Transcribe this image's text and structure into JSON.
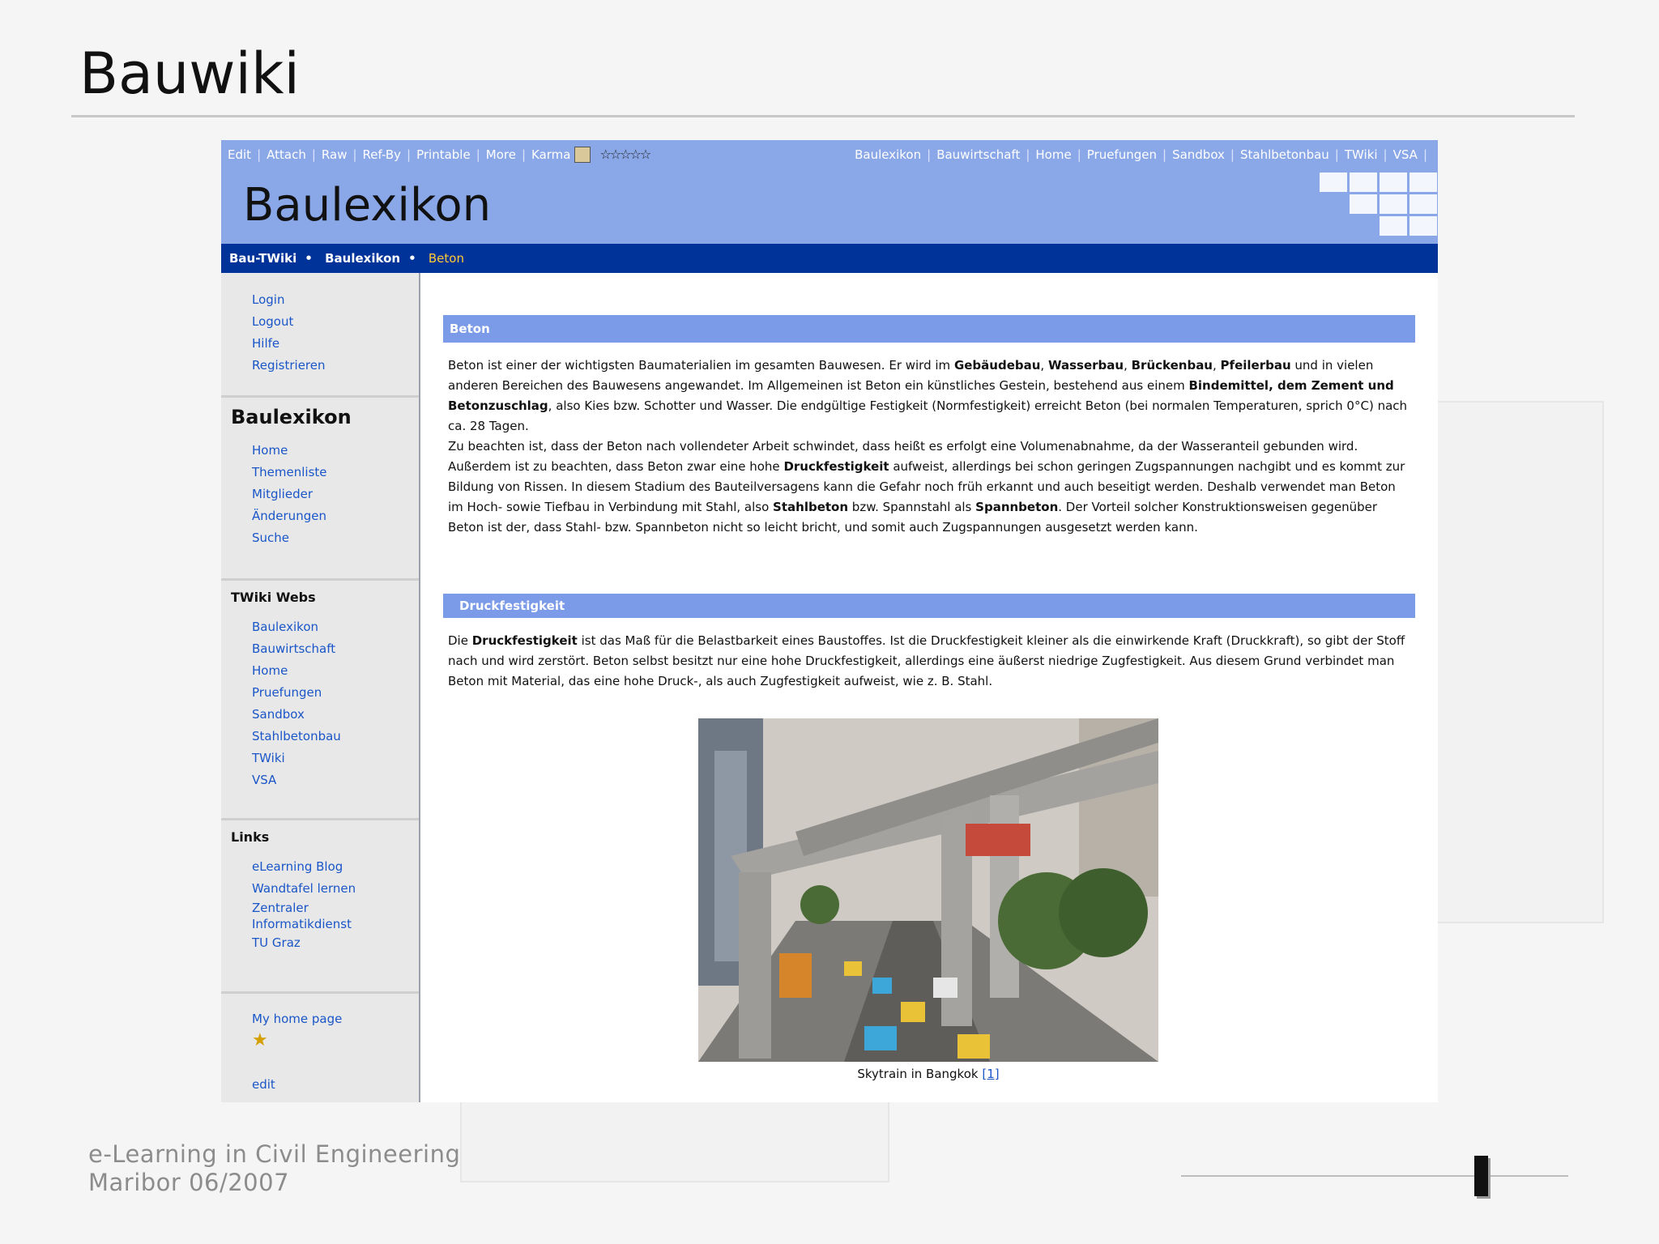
{
  "slide": {
    "title": "Bauwiki",
    "footer_line1": "e-Learning in Civil Engineering",
    "footer_line2": "Maribor 06/2007"
  },
  "toolbar": {
    "left_links": [
      "Edit",
      "Attach",
      "Raw",
      "Ref-By",
      "Printable",
      "More",
      "Karma"
    ],
    "rating_glyph": "☆☆☆☆☆",
    "right_links": [
      "Baulexikon",
      "Bauwirtschaft",
      "Home",
      "Pruefungen",
      "Sandbox",
      "Stahlbetonbau",
      "TWiki",
      "VSA"
    ]
  },
  "web_title": "Baulexikon",
  "breadcrumb": {
    "items": [
      "Bau-TWiki",
      "Baulexikon"
    ],
    "current": "Beton"
  },
  "sidebar": {
    "account_links": [
      "Login",
      "Logout",
      "Hilfe",
      "Registrieren"
    ],
    "web_heading": "Baulexikon",
    "web_links": [
      "Home",
      "Themenliste",
      "Mitglieder",
      "Änderungen",
      "Suche"
    ],
    "webs_heading": "TWiki Webs",
    "webs_links": [
      "Baulexikon",
      "Bauwirtschaft",
      "Home",
      "Pruefungen",
      "Sandbox",
      "Stahlbetonbau",
      "TWiki",
      "VSA"
    ],
    "links_heading": "Links",
    "links": [
      "eLearning Blog",
      "Wandtafel lernen",
      "Zentraler Informatikdienst",
      "TU Graz"
    ],
    "home_link": "My home page",
    "edit_link": "edit"
  },
  "article": {
    "section1_title": "Beton",
    "p1_a": "Beton ist einer der wichtigsten Baumaterialien im gesamten Bauwesen. Er wird im ",
    "p1_k1": "Gebäudebau",
    "p1_s1": ", ",
    "p1_k2": "Wasserbau",
    "p1_s2": ", ",
    "p1_k3": "Brückenbau",
    "p1_s3": ", ",
    "p1_k4": "Pfeilerbau",
    "p1_b": " und in vielen anderen Bereichen des Bauwesens angewandet. Im Allgemeinen ist Beton ein künstliches Gestein, bestehend aus einem ",
    "p1_k5": "Bindemittel, dem Zement und Betonzuschlag",
    "p1_c": ", also Kies bzw. Schotter und Wasser. Die endgültige Festigkeit (Normfestigkeit) erreicht Beton (bei normalen Temperaturen, sprich 0°C) nach ca. 28 Tagen.",
    "p2_a": "Zu beachten ist, dass der Beton nach vollendeter Arbeit schwindet, dass heißt es erfolgt eine Volumenabnahme, da der Wasseranteil gebunden wird. Außerdem ist zu beachten, dass Beton zwar eine hohe ",
    "p2_k1": "Druckfestigkeit",
    "p2_b": " aufweist, allerdings bei schon geringen Zugspannungen nachgibt und es kommt zur Bildung von Rissen. In diesem Stadium des Bauteilversagens kann die Gefahr noch früh erkannt und auch beseitigt werden. Deshalb verwendet man Beton im Hoch- sowie Tiefbau in Verbindung mit Stahl, also ",
    "p2_k2": "Stahlbeton",
    "p2_c": " bzw. Spannstahl als ",
    "p2_k3": "Spannbeton",
    "p2_d": ". Der Vorteil solcher Konstruktionsweisen gegenüber Beton ist der, dass Stahl- bzw. Spannbeton nicht so leicht bricht, und somit auch Zugspannungen ausgesetzt werden kann.",
    "section2_title": "Druckfestigkeit",
    "p3_a": "Die ",
    "p3_k1": "Druckfestigkeit",
    "p3_b": " ist das Maß für die Belastbarkeit eines Baustoffes. Ist die Druckfestigkeit kleiner als die einwirkende Kraft (Druckkraft), so gibt der Stoff nach und wird zerstört. Beton selbst besitzt nur eine hohe Druckfestigkeit, allerdings eine äußerst niedrige Zugfestigkeit. Aus diesem Grund verbindet man Beton mit Material, das eine hohe Druck-, als auch Zugfestigkeit aufweist, wie z. B. Stahl.",
    "caption": "Skytrain in Bangkok",
    "caption_ref": "[1]"
  }
}
